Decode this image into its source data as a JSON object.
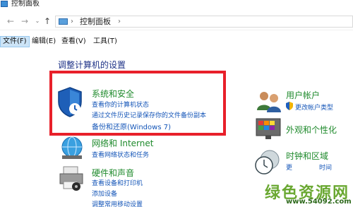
{
  "window": {
    "title": "控制面板"
  },
  "address": {
    "crumb": "控制面板",
    "separator": "›"
  },
  "nav": {
    "back": "←",
    "forward": "→",
    "recent": "⌄",
    "up": "↑"
  },
  "menu": [
    "文件(F)",
    "编辑(E)",
    "查看(V)",
    "工具(T)"
  ],
  "heading": "调整计算机的设置",
  "categories": {
    "system": {
      "title": "系统和安全",
      "links": [
        "查看你的计算机状态",
        "通过文件历史记录保存你的文件备份副本",
        "备份和还原(Windows 7)"
      ]
    },
    "network": {
      "title": "网络和 Internet",
      "links": [
        "查看网络状态和任务"
      ]
    },
    "hardware": {
      "title": "硬件和声音",
      "links": [
        "查看设备和打印机",
        "添加设备",
        "调整常用移动设置"
      ]
    },
    "users": {
      "title": "用户帐户",
      "links": [
        "更改帐户类型"
      ]
    },
    "appearance": {
      "title": "外观和个性化",
      "links": []
    },
    "clock": {
      "title": "时钟和区域",
      "links": [
        "更",
        "时间"
      ]
    }
  },
  "watermark": {
    "text": "绿色资源网",
    "url": "www.54092.com"
  }
}
